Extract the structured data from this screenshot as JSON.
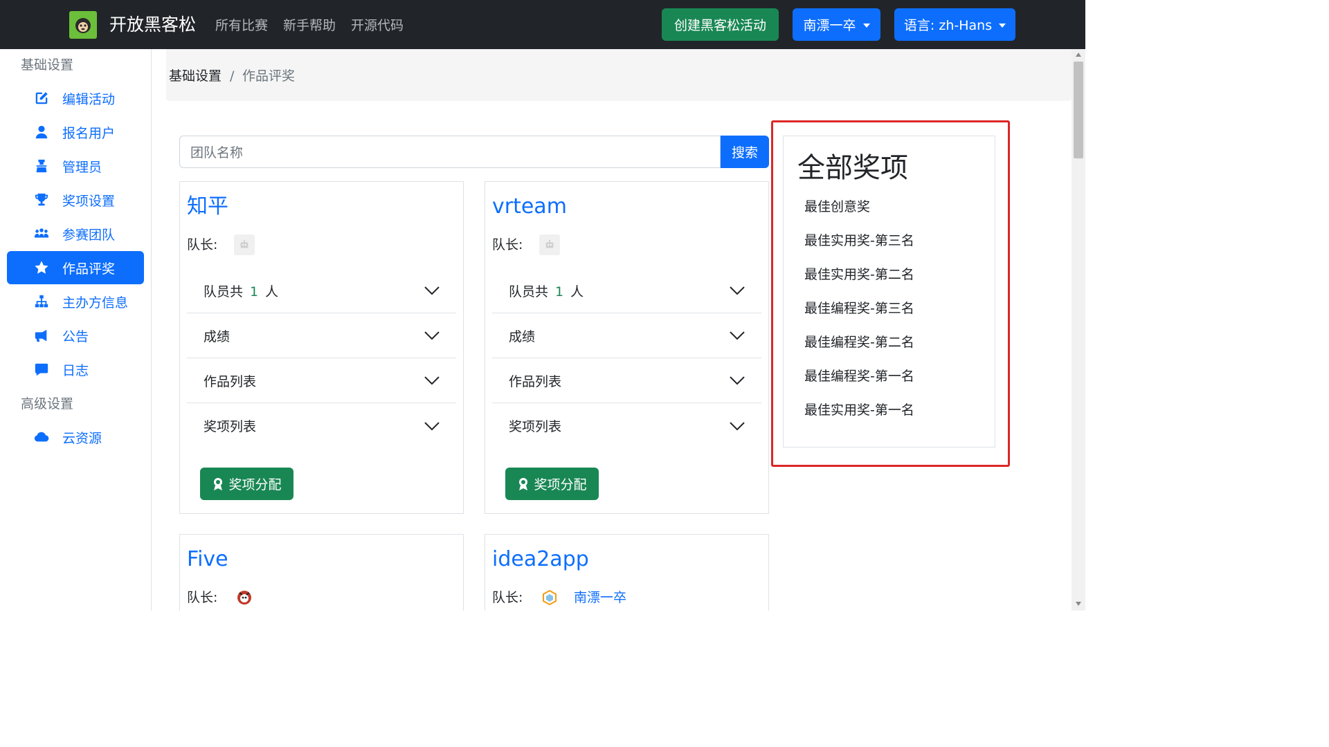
{
  "navbar": {
    "brand_title": "开放黑客松",
    "links": [
      "所有比赛",
      "新手帮助",
      "开源代码"
    ],
    "create_button": "创建黑客松活动",
    "user_menu": "南漂一卒",
    "language_menu": "语言: zh-Hans"
  },
  "sidebar": {
    "basic_header": "基础设置",
    "advanced_header": "高级设置",
    "items": [
      {
        "label": "编辑活动",
        "icon": "edit-icon"
      },
      {
        "label": "报名用户",
        "icon": "user-icon"
      },
      {
        "label": "管理员",
        "icon": "admin-icon"
      },
      {
        "label": "奖项设置",
        "icon": "trophy-icon"
      },
      {
        "label": "参赛团队",
        "icon": "people-icon"
      },
      {
        "label": "作品评奖",
        "icon": "star-icon",
        "active": true
      },
      {
        "label": "主办方信息",
        "icon": "sitemap-icon"
      },
      {
        "label": "公告",
        "icon": "megaphone-icon"
      },
      {
        "label": "日志",
        "icon": "comment-icon"
      },
      {
        "label": "云资源",
        "icon": "cloud-icon"
      }
    ]
  },
  "breadcrumb": {
    "parent": "基础设置",
    "separator": "/",
    "current": "作品评奖"
  },
  "search": {
    "placeholder": "团队名称",
    "button": "搜索"
  },
  "teams": [
    {
      "name": "知平",
      "leader_label": "队长:",
      "leader_name": "",
      "members_prefix": "队员共",
      "members_count": "1",
      "members_suffix": "人",
      "sections": [
        "成绩",
        "作品列表",
        "奖项列表"
      ],
      "award_button": "奖项分配"
    },
    {
      "name": "vrteam",
      "leader_label": "队长:",
      "leader_name": "",
      "members_prefix": "队员共",
      "members_count": "1",
      "members_suffix": "人",
      "sections": [
        "成绩",
        "作品列表",
        "奖项列表"
      ],
      "award_button": "奖项分配"
    },
    {
      "name": "Five",
      "leader_label": "队长:",
      "leader_name": ""
    },
    {
      "name": "idea2app",
      "leader_label": "队长:",
      "leader_name": "南漂一卒"
    }
  ],
  "awards": {
    "title": "全部奖项",
    "items": [
      "最佳创意奖",
      "最佳实用奖-第三名",
      "最佳实用奖-第二名",
      "最佳编程奖-第三名",
      "最佳编程奖-第二名",
      "最佳编程奖-第一名",
      "最佳实用奖-第一名"
    ]
  },
  "colors": {
    "primary": "#0d6efd",
    "success": "#198754",
    "navbar": "#212529",
    "highlight": "#dc2626"
  }
}
